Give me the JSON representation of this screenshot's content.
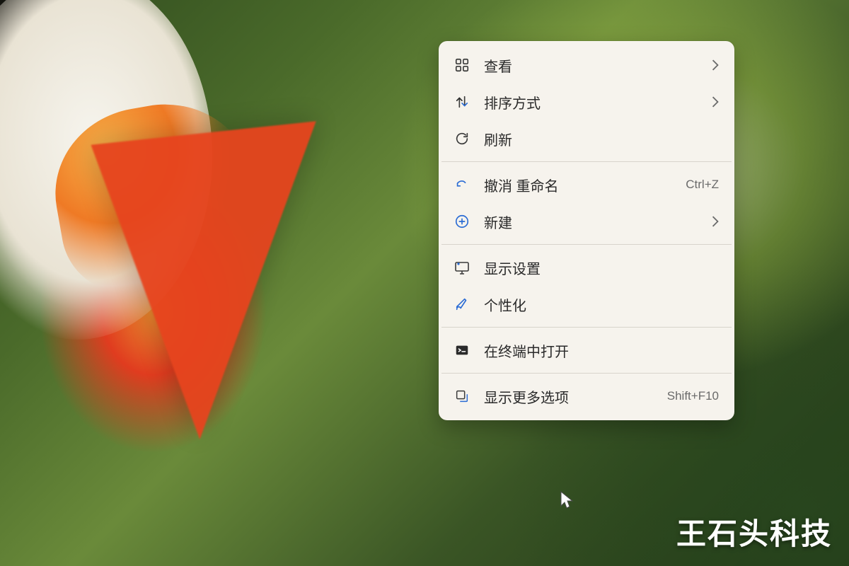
{
  "menu": {
    "view": {
      "label": "查看",
      "has_submenu": true
    },
    "sort": {
      "label": "排序方式",
      "has_submenu": true
    },
    "refresh": {
      "label": "刷新"
    },
    "undo": {
      "label": "撤消 重命名",
      "shortcut": "Ctrl+Z"
    },
    "new": {
      "label": "新建",
      "has_submenu": true
    },
    "display": {
      "label": "显示设置"
    },
    "personalize": {
      "label": "个性化"
    },
    "terminal": {
      "label": "在终端中打开"
    },
    "more": {
      "label": "显示更多选项",
      "shortcut": "Shift+F10"
    }
  },
  "watermark": "王石头科技"
}
